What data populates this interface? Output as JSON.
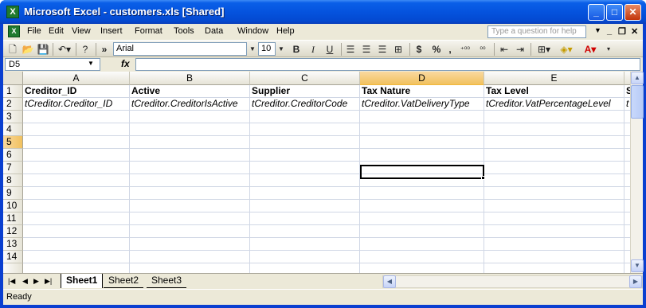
{
  "window": {
    "title": "Microsoft Excel - customers.xls  [Shared]"
  },
  "menu": [
    "File",
    "Edit",
    "View",
    "Insert",
    "Format",
    "Tools",
    "Data",
    "Window",
    "Help"
  ],
  "help_placeholder": "Type a question for help",
  "toolbar": {
    "font": "Arial",
    "size": "10",
    "bold": "B",
    "italic": "I",
    "underline": "U",
    "currency": "$",
    "percent": "%",
    "comma": ","
  },
  "formula": {
    "namebox": "D5",
    "fx": "fx",
    "value": ""
  },
  "columns": [
    "A",
    "B",
    "C",
    "D",
    "E"
  ],
  "selected_column": "D",
  "rows": [
    "1",
    "2",
    "3",
    "4",
    "5",
    "6",
    "7",
    "8",
    "9",
    "10",
    "11",
    "12",
    "13",
    "14"
  ],
  "selected_row": "5",
  "cells": {
    "r1": [
      "Creditor_ID",
      "Active",
      "Supplier",
      "Tax Nature",
      "Tax Level",
      "S"
    ],
    "r2": [
      "tCreditor.Creditor_ID",
      "tCreditor.CreditorIsActive",
      "tCreditor.CreditorCode",
      "tCreditor.VatDeliveryType",
      "tCreditor.VatPercentageLevel",
      "t"
    ]
  },
  "sheets": [
    "Sheet1",
    "Sheet2",
    "Sheet3"
  ],
  "active_sheet": "Sheet1",
  "status": "Ready"
}
